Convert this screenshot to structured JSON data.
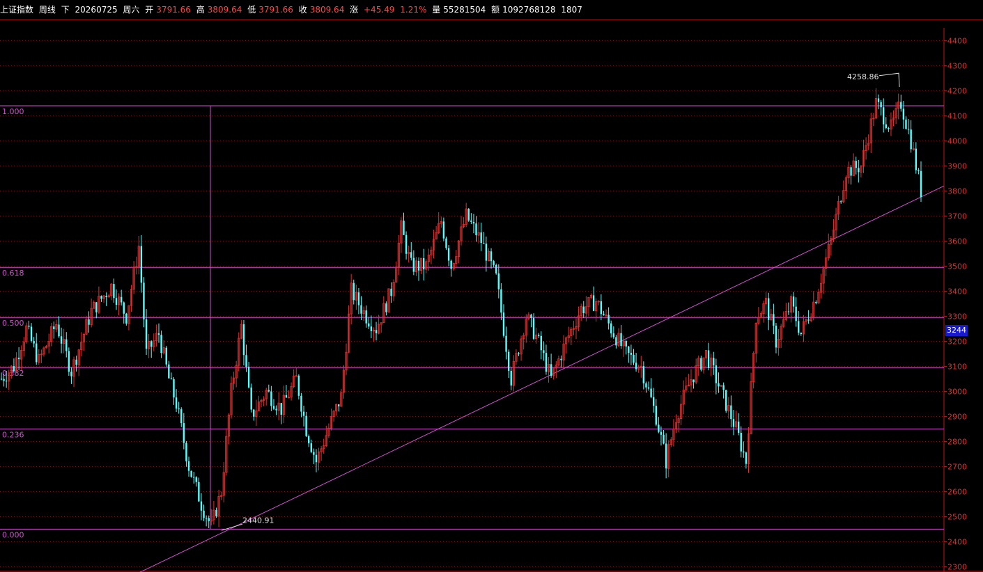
{
  "header": {
    "index_name": "上证指数",
    "period": "周线",
    "fuquan": "下",
    "date": "20260725",
    "weekday": "周六",
    "open_label": "开",
    "open": "3791.66",
    "high_label": "高",
    "high": "3809.64",
    "low_label": "低",
    "low": "3791.66",
    "close_label": "收",
    "close": "3809.64",
    "change_label": "涨",
    "change": "+45.49",
    "change_pct": "1.21%",
    "volume_label": "量",
    "volume": "55281504",
    "amount_label": "额",
    "amount": "1092768128",
    "extra": "1807"
  },
  "current_price_tag": "3244",
  "colors": {
    "background": "#000000",
    "axis_red": "#c01818",
    "grid_red": "#7a1a1a",
    "up_candle": "#e03030",
    "down_candle": "#54ffff",
    "fib_line": "#d050d0",
    "label_white": "#e0e0e0"
  },
  "chart_data": {
    "type": "candlestick",
    "y_axis": {
      "ticks": [
        2300,
        2400,
        2500,
        2600,
        2700,
        2800,
        2900,
        3000,
        3100,
        3200,
        3300,
        3400,
        3500,
        3600,
        3700,
        3800,
        3900,
        4000,
        4100,
        4200,
        4300,
        4400
      ],
      "ylim": [
        2290,
        4440
      ]
    },
    "fibonacci": [
      {
        "ratio": "1.000",
        "price": 4140
      },
      {
        "ratio": "0.618",
        "price": 3495
      },
      {
        "ratio": "0.500",
        "price": 3295
      },
      {
        "ratio": "0.382",
        "price": 3095
      },
      {
        "ratio": "0.236",
        "price": 2850
      },
      {
        "ratio": "0.000",
        "price": 2450
      }
    ],
    "annotations": [
      {
        "text": "4258.86",
        "kind": "high"
      },
      {
        "text": "2440.91",
        "kind": "low"
      }
    ],
    "trendline": {
      "from_price": 2250,
      "to_price": 3820
    },
    "anchors": [
      {
        "i": 0,
        "p": 3050
      },
      {
        "i": 5,
        "p": 3100
      },
      {
        "i": 10,
        "p": 3250
      },
      {
        "i": 15,
        "p": 3120
      },
      {
        "i": 22,
        "p": 3270
      },
      {
        "i": 28,
        "p": 3080
      },
      {
        "i": 36,
        "p": 3320
      },
      {
        "i": 44,
        "p": 3420
      },
      {
        "i": 50,
        "p": 3300
      },
      {
        "i": 55,
        "p": 3580
      },
      {
        "i": 58,
        "p": 3150
      },
      {
        "i": 63,
        "p": 3230
      },
      {
        "i": 67,
        "p": 3050
      },
      {
        "i": 70,
        "p": 2950
      },
      {
        "i": 75,
        "p": 2700
      },
      {
        "i": 80,
        "p": 2550
      },
      {
        "i": 84,
        "p": 2460
      },
      {
        "i": 88,
        "p": 2600
      },
      {
        "i": 92,
        "p": 3000
      },
      {
        "i": 96,
        "p": 3260
      },
      {
        "i": 100,
        "p": 2900
      },
      {
        "i": 106,
        "p": 3000
      },
      {
        "i": 112,
        "p": 2930
      },
      {
        "i": 118,
        "p": 3050
      },
      {
        "i": 122,
        "p": 2850
      },
      {
        "i": 126,
        "p": 2720
      },
      {
        "i": 132,
        "p": 2880
      },
      {
        "i": 136,
        "p": 2980
      },
      {
        "i": 140,
        "p": 3400
      },
      {
        "i": 146,
        "p": 3300
      },
      {
        "i": 150,
        "p": 3250
      },
      {
        "i": 156,
        "p": 3400
      },
      {
        "i": 160,
        "p": 3650
      },
      {
        "i": 164,
        "p": 3500
      },
      {
        "i": 170,
        "p": 3500
      },
      {
        "i": 176,
        "p": 3680
      },
      {
        "i": 180,
        "p": 3500
      },
      {
        "i": 186,
        "p": 3700
      },
      {
        "i": 192,
        "p": 3600
      },
      {
        "i": 198,
        "p": 3450
      },
      {
        "i": 204,
        "p": 3050
      },
      {
        "i": 210,
        "p": 3300
      },
      {
        "i": 214,
        "p": 3220
      },
      {
        "i": 220,
        "p": 3050
      },
      {
        "i": 226,
        "p": 3200
      },
      {
        "i": 232,
        "p": 3330
      },
      {
        "i": 238,
        "p": 3360
      },
      {
        "i": 244,
        "p": 3250
      },
      {
        "i": 250,
        "p": 3150
      },
      {
        "i": 256,
        "p": 3100
      },
      {
        "i": 262,
        "p": 2900
      },
      {
        "i": 266,
        "p": 2720
      },
      {
        "i": 270,
        "p": 2900
      },
      {
        "i": 276,
        "p": 3050
      },
      {
        "i": 282,
        "p": 3150
      },
      {
        "i": 288,
        "p": 3000
      },
      {
        "i": 294,
        "p": 2850
      },
      {
        "i": 298,
        "p": 2720
      },
      {
        "i": 302,
        "p": 3300
      },
      {
        "i": 306,
        "p": 3350
      },
      {
        "i": 310,
        "p": 3200
      },
      {
        "i": 316,
        "p": 3350
      },
      {
        "i": 320,
        "p": 3230
      },
      {
        "i": 326,
        "p": 3380
      },
      {
        "i": 332,
        "p": 3600
      },
      {
        "i": 338,
        "p": 3880
      },
      {
        "i": 344,
        "p": 3900
      },
      {
        "i": 350,
        "p": 4150
      },
      {
        "i": 356,
        "p": 4050
      },
      {
        "i": 360,
        "p": 4150
      },
      {
        "i": 364,
        "p": 4000
      },
      {
        "i": 368,
        "p": 3800
      }
    ],
    "candle_count": 369
  }
}
